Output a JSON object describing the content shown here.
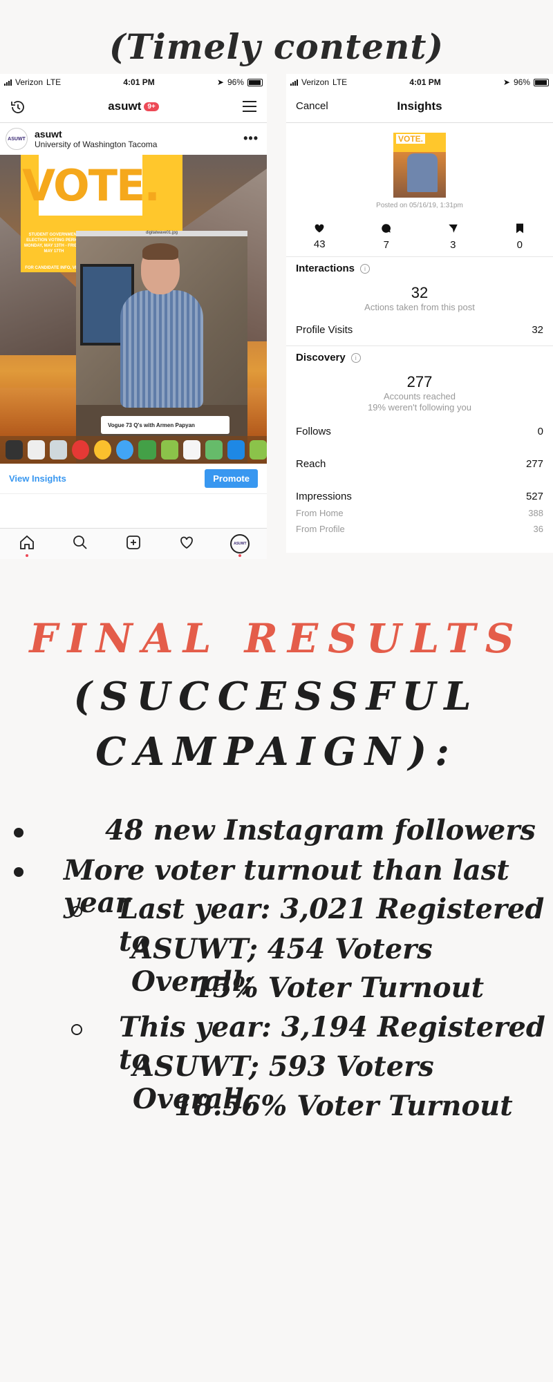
{
  "caption": "(Timely content)",
  "left_phone": {
    "status": {
      "carrier": "Verizon",
      "network": "LTE",
      "time": "4:01 PM",
      "battery": "96%"
    },
    "nav": {
      "title": "asuwt",
      "badge": "9+"
    },
    "post": {
      "username": "asuwt",
      "location": "University of Washington Tacoma",
      "avatar_text": "ASUWT",
      "image_headline": "VOTE.",
      "image_info": "STUDENT GOVERNMENT ELECTION VOTING PERIOD MONDAY, MAY 13TH - FRIDAY, MAY 17TH",
      "image_footer": "FOR CANDIDATE INFO, VISIT",
      "video_filename": "digitalwave01.jpg",
      "video_search_text": "Vogue 73 Q's with Armen Papyan"
    },
    "actions": {
      "view_insights": "View Insights",
      "promote": "Promote"
    },
    "tabs": [
      "home-icon",
      "search-icon",
      "add-post-icon",
      "heart-icon",
      "profile-icon"
    ]
  },
  "right_phone": {
    "status": {
      "carrier": "Verizon",
      "network": "LTE",
      "time": "4:01 PM",
      "battery": "96%"
    },
    "nav": {
      "cancel": "Cancel",
      "title": "Insights"
    },
    "thumb_text": "VOTE.",
    "posted": "Posted on 05/16/19, 1:31pm",
    "stats": {
      "likes": "43",
      "comments": "7",
      "shares": "3",
      "saves": "0"
    },
    "interactions": {
      "title": "Interactions",
      "count": "32",
      "caption": "Actions taken from this post",
      "profile_visits_label": "Profile Visits",
      "profile_visits": "32"
    },
    "discovery": {
      "title": "Discovery",
      "count": "277",
      "caption1": "Accounts reached",
      "caption2": "19% weren't following you",
      "follows_label": "Follows",
      "follows": "0",
      "reach_label": "Reach",
      "reach": "277",
      "impressions_label": "Impressions",
      "impressions": "527",
      "from_home_label": "From Home",
      "from_home": "388",
      "from_profile_label": "From Profile",
      "from_profile": "36"
    }
  },
  "results": {
    "title": "FINAL RESULTS",
    "subtitle_line1": "(SUCCESSFUL",
    "subtitle_line2": "CAMPAIGN):",
    "bullet1": "48 new Instagram followers",
    "bullet2": "More voter turnout than last year",
    "last_year_1": "Last year: 3,021 Registered to",
    "last_year_2": "ASUWT; 454 Voters Overall;",
    "last_year_3": "15% Voter Turnout",
    "this_year_1": "This year: 3,194 Registered to",
    "this_year_2": "ASUWT; 593 Voters Overall;",
    "this_year_3": "18.56% Voter Turnout"
  },
  "colors": {
    "accent": "#3897f0",
    "badge": "#ed4956",
    "title_red": "#e45d4a",
    "vote_yellow": "#ffc72c"
  }
}
